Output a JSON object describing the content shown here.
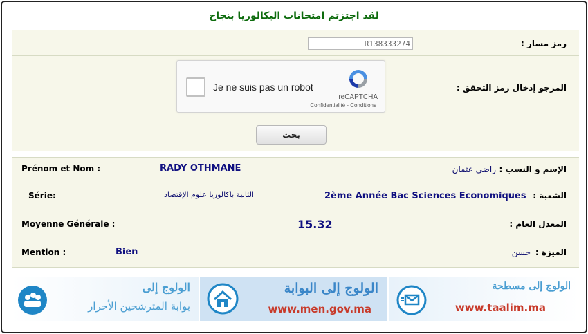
{
  "page": {
    "title": "لقد اجتزتم امتحانات البكالوريا بنجاح"
  },
  "form": {
    "massar_label": "رمز مسار :",
    "massar_value": "R138333274",
    "captcha_label": "المرجو إدخال رمز التحقق :",
    "captcha": {
      "checkbox_text": "Je ne suis pas un robot",
      "brand": "reCAPTCHA",
      "links": "Confidentialité - Conditions"
    },
    "search_button": "بحث"
  },
  "result": {
    "name_fr_label": "Prénom et Nom :",
    "name_fr_value": "RADY OTHMANE",
    "name_ar_label": "الإسم و النسب :",
    "name_ar_value": "راضي عثمان",
    "serie_fr_label": "Série:",
    "serie_ar_value": "الثانية باكالوريا علوم الإقتصاد",
    "branch_ar_label": "الشعبة :",
    "branch_fr_value": "2ème Année Bac Sciences Economiques",
    "avg_fr_label": "Moyenne Générale :",
    "avg_value": "15.32",
    "avg_ar_label": "المعدل العام :",
    "mention_fr_label": "Mention :",
    "mention_fr_value": "Bien",
    "mention_ar_label": "الميزة :",
    "mention_ar_value": "حسن"
  },
  "banners": [
    {
      "title": "الولوج إلى",
      "subtitle": "بوابة المترشحين الأحرار",
      "icon": "candidates-icon"
    },
    {
      "title": "الولوج إلى البوابة",
      "url": "www.men.gov.ma",
      "icon": "home-icon"
    },
    {
      "title": "الولوج إلى مسطحة",
      "url": "www.taalim.ma",
      "icon": "mail-icon"
    }
  ]
}
